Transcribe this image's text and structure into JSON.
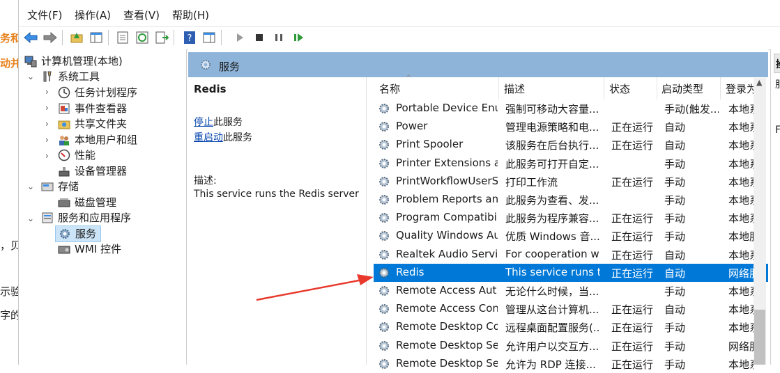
{
  "background_fragments": [
    "务和",
    "动并",
    "，贝",
    "示验",
    "字的"
  ],
  "menu": [
    "文件(F)",
    "操作(A)",
    "查看(V)",
    "帮助(H)"
  ],
  "tree": {
    "root": "计算机管理(本地)",
    "system_tools": "系统工具",
    "task_scheduler": "任务计划程序",
    "event_viewer": "事件查看器",
    "shared_folders": "共享文件夹",
    "local_users": "本地用户和组",
    "performance": "性能",
    "device_manager": "设备管理器",
    "storage": "存储",
    "disk_management": "磁盘管理",
    "services_apps": "服务和应用程序",
    "services": "服务",
    "wmi": "WMI 控件"
  },
  "panel": {
    "header": "服务",
    "selected_service": "Redis",
    "stop_link": "停止",
    "stop_suffix": "此服务",
    "restart_link": "重启动",
    "restart_suffix": "此服务",
    "desc_label": "描述:",
    "desc_text": "This service runs the Redis server"
  },
  "columns": {
    "name": "名称",
    "desc": "描述",
    "status": "状态",
    "startup": "启动类型",
    "logon": "登录为"
  },
  "rows": [
    {
      "name": "Portable Device Enu...",
      "desc": "强制可移动大容量...",
      "status": "",
      "startup": "手动(触发...",
      "logon": "本地系统"
    },
    {
      "name": "Power",
      "desc": "管理电源策略和电...",
      "status": "正在运行",
      "startup": "自动",
      "logon": "本地系统"
    },
    {
      "name": "Print Spooler",
      "desc": "该服务在后台执行...",
      "status": "正在运行",
      "startup": "自动",
      "logon": "本地系统"
    },
    {
      "name": "Printer Extensions a...",
      "desc": "此服务可打开自定...",
      "status": "",
      "startup": "手动",
      "logon": "本地系统"
    },
    {
      "name": "PrintWorkflowUserS...",
      "desc": "打印工作流",
      "status": "正在运行",
      "startup": "手动",
      "logon": "本地系统"
    },
    {
      "name": "Problem Reports an...",
      "desc": "此服务为查看、发...",
      "status": "",
      "startup": "手动",
      "logon": "本地系统"
    },
    {
      "name": "Program Compatibil...",
      "desc": "此服务为程序兼容...",
      "status": "正在运行",
      "startup": "手动",
      "logon": "本地系统"
    },
    {
      "name": "Quality Windows Au...",
      "desc": "优质 Windows 音...",
      "status": "正在运行",
      "startup": "手动",
      "logon": "本地服务"
    },
    {
      "name": "Realtek Audio Service",
      "desc": "For cooperation wi...",
      "status": "正在运行",
      "startup": "自动",
      "logon": "本地系统"
    },
    {
      "name": "Redis",
      "desc": "This service runs t...",
      "status": "正在运行",
      "startup": "自动",
      "logon": "网络服务"
    },
    {
      "name": "Remote Access Aut...",
      "desc": "无论什么时候，当...",
      "status": "",
      "startup": "手动",
      "logon": "本地系统"
    },
    {
      "name": "Remote Access Con...",
      "desc": "管理从这台计算机...",
      "status": "正在运行",
      "startup": "自动",
      "logon": "本地系统"
    },
    {
      "name": "Remote Desktop Co...",
      "desc": "远程桌面配置服务(...",
      "status": "正在运行",
      "startup": "手动",
      "logon": "本地系统"
    },
    {
      "name": "Remote Desktop Se...",
      "desc": "允许用户以交互方...",
      "status": "正在运行",
      "startup": "手动",
      "logon": "网络服务"
    },
    {
      "name": "Remote Desktop Se...",
      "desc": "允许为 RDP 连接...",
      "status": "正在运行",
      "startup": "手动",
      "logon": "本地系统"
    }
  ],
  "right_pane": {
    "title": "操",
    "item1": "服",
    "item2": "F"
  },
  "colors": {
    "selection": "#0078d7",
    "header_bar": "#8fb4d9",
    "arrow": "#e8392c",
    "link": "#0645ad"
  }
}
